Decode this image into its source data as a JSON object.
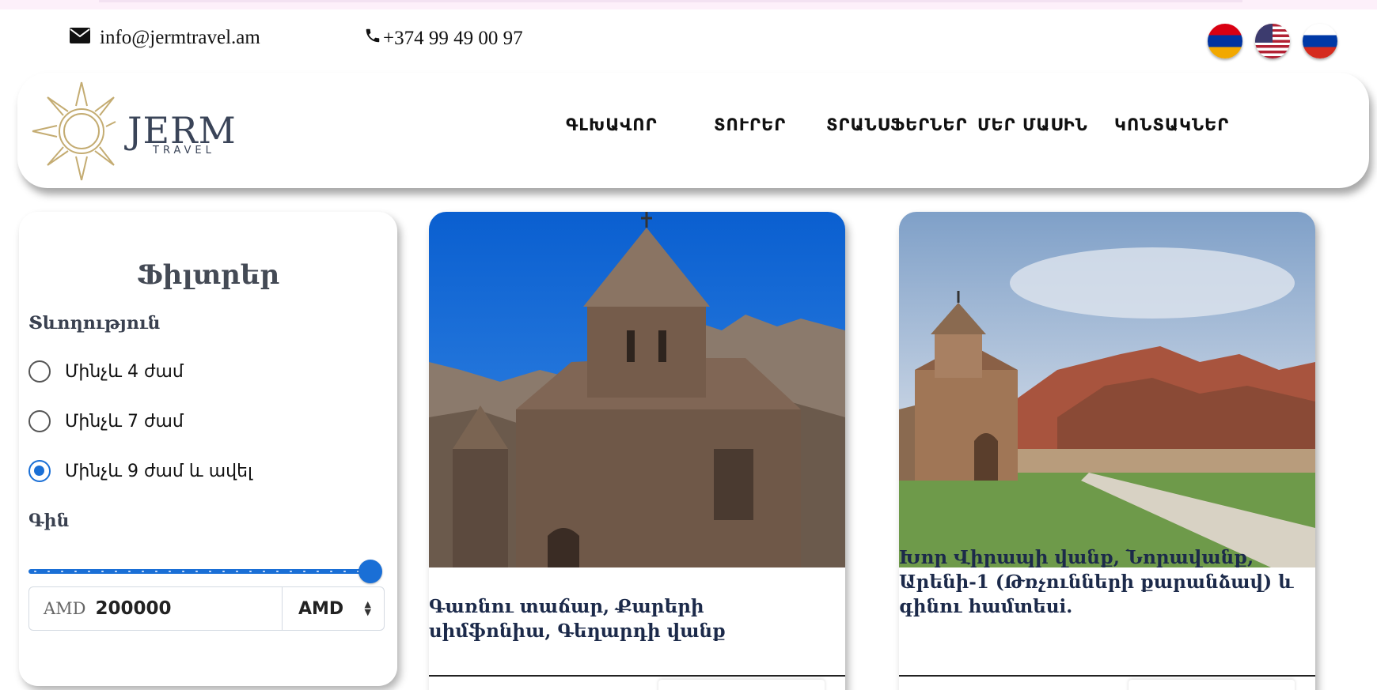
{
  "contact": {
    "email": "info@jermtravel.am",
    "phone": "+374 99 49 00 97"
  },
  "languages": [
    {
      "code": "am",
      "icon": "armenia-flag-icon"
    },
    {
      "code": "en",
      "icon": "usa-flag-icon"
    },
    {
      "code": "ru",
      "icon": "russia-flag-icon"
    }
  ],
  "logo": {
    "word": "JERM",
    "sub": "TRAVEL"
  },
  "nav": [
    "ԳԼԽԱՎՈՐ",
    "ՏՈՒՐԵՐ",
    "ՏՐԱՆՍՖԵՐՆԵՐ",
    "ՄԵՐ ՄԱՍԻՆ",
    "ԿՈՆՏԱԿՆԵՐ"
  ],
  "filter": {
    "title": "Ֆիլտրեր",
    "duration_label": "Տևողություն",
    "options": [
      "Մինչև 4 ժամ",
      "Մինչև 7 ժամ",
      "Մինչև 9 ժամ և ավել"
    ],
    "selected_index": 2,
    "price_label": "Գին",
    "price_slider_fraction": 1.0,
    "price_prefix": "AMD",
    "price_value": "200000",
    "currency": "AMD"
  },
  "tours": [
    {
      "title": "Գառնու տաճար, Քարերի սիմֆոնիա, Գեղարդի վանք",
      "image": "geghard-monastery-photo"
    },
    {
      "title": "Խոր Վիրապի վանք, Նորավանք, Արենի-1 (Թռչունների քարանձավ) և գինու համտեսi.",
      "image": "noravank-monastery-photo"
    }
  ],
  "colors": {
    "accent": "#1a6fd6",
    "logo_text": "#3a4458",
    "logo_gold": "#c4ac72",
    "card_title": "#1c2a4a"
  }
}
